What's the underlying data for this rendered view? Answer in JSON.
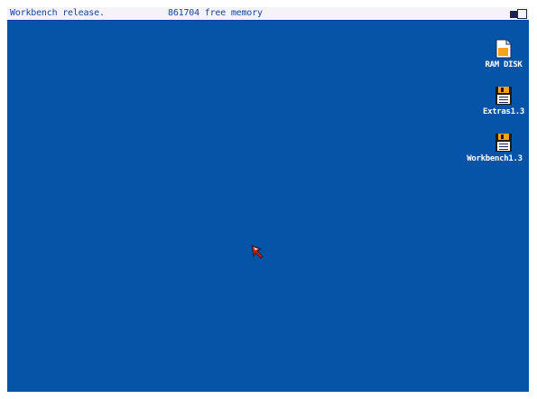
{
  "screen": {
    "title": "Workbench release.",
    "memory": "861704 free memory",
    "background_color": "#0654a7",
    "titlebar_color": "#f4f4f8",
    "text_color": "#1a3f9f"
  },
  "gadgets": {
    "depth_back": "depth-back-gadget",
    "depth_front": "depth-front-gadget"
  },
  "icons": [
    {
      "label": "RAM DISK",
      "icon": "ram-disk-icon"
    },
    {
      "label": "Extras1.3",
      "icon": "floppy-disk-icon"
    },
    {
      "label": "Workbench1.3",
      "icon": "floppy-disk-icon"
    }
  ],
  "pointer": {
    "icon": "mouse-pointer-icon"
  }
}
